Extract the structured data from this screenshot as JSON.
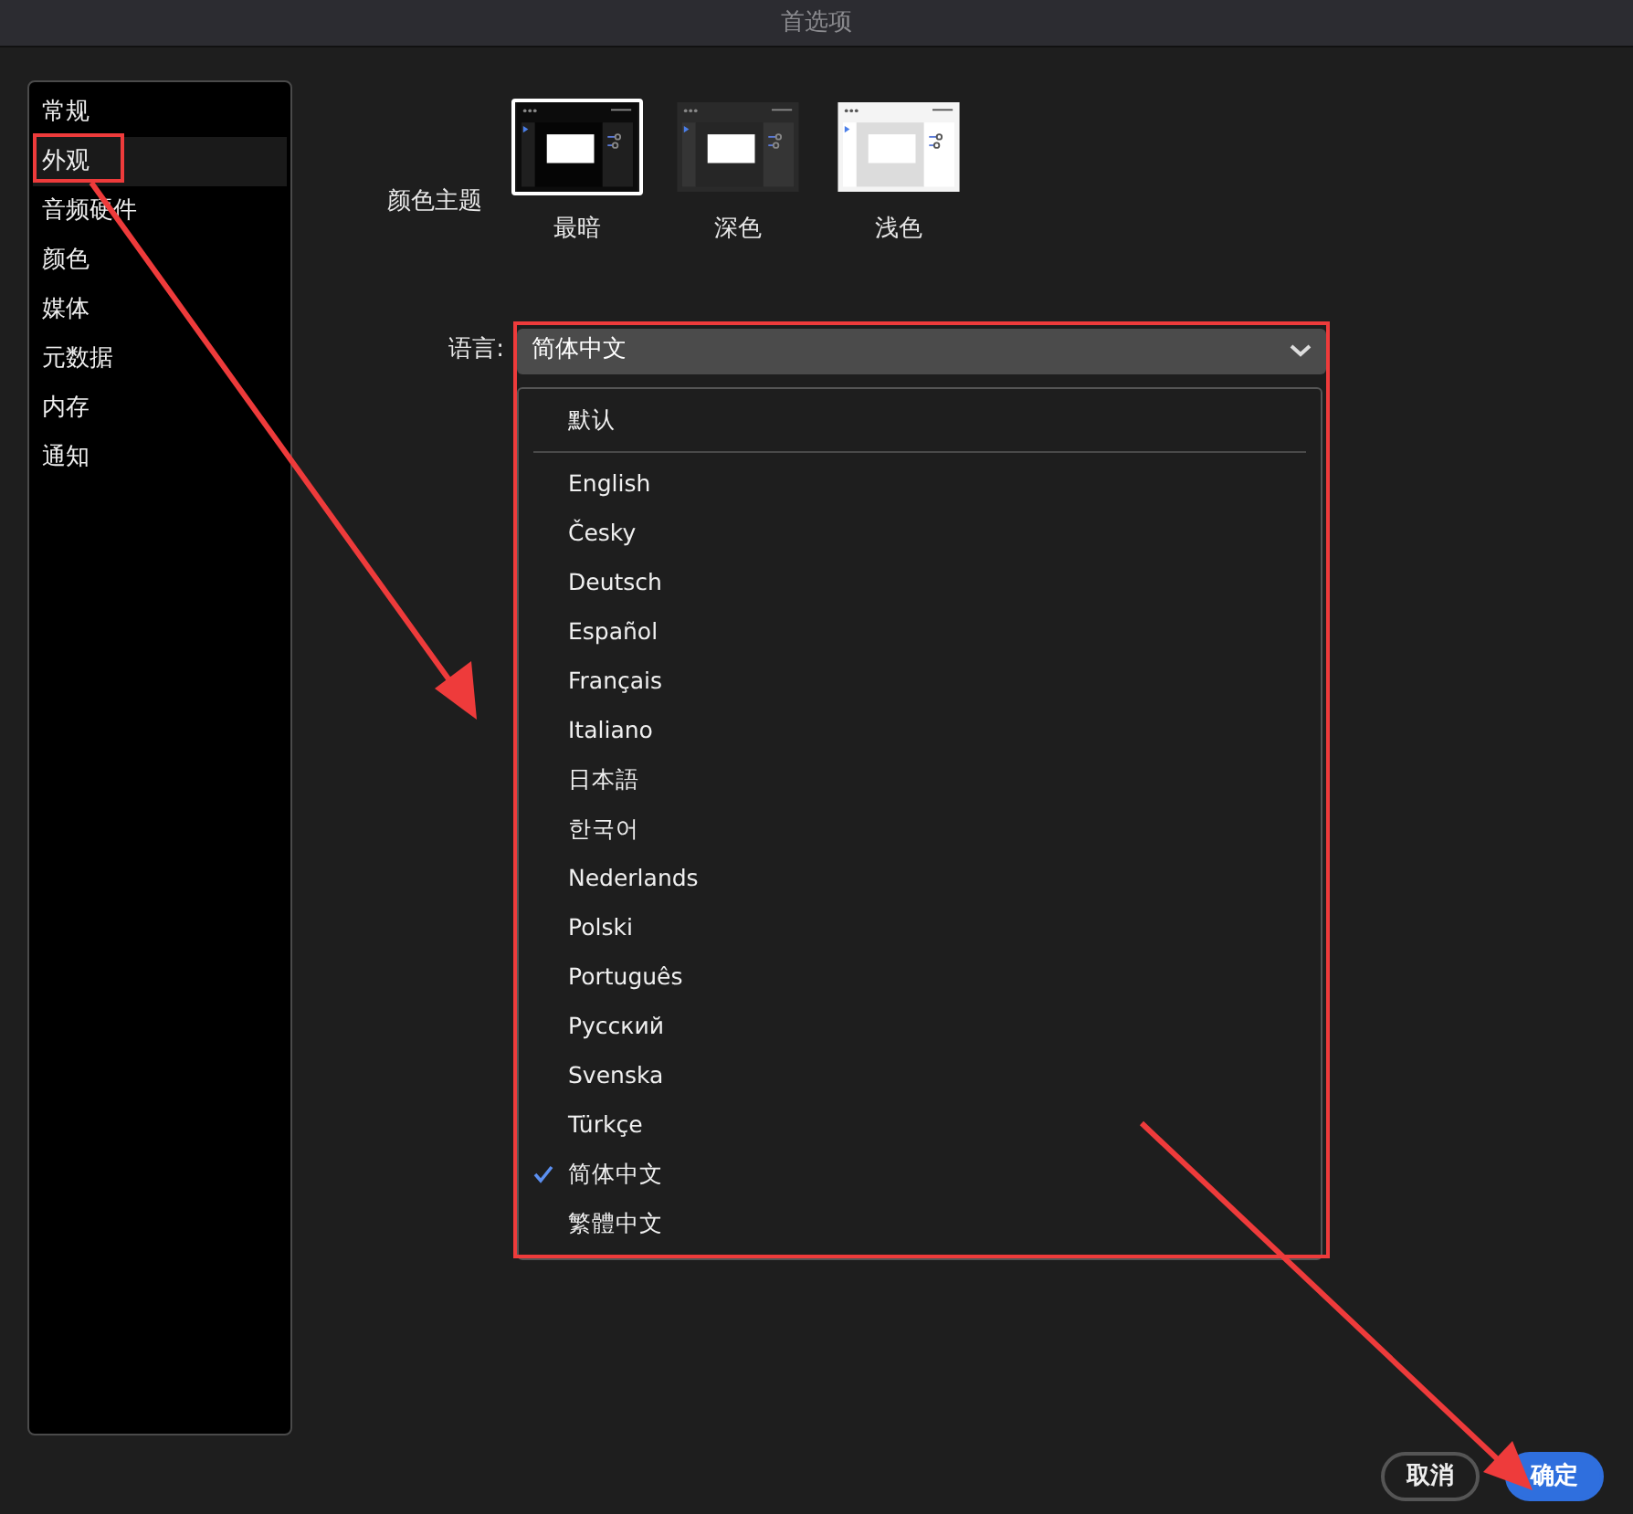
{
  "window": {
    "title": "首选项"
  },
  "sidebar": {
    "items": [
      {
        "label": "常规",
        "selected": false
      },
      {
        "label": "外观",
        "selected": true
      },
      {
        "label": "音频硬件",
        "selected": false
      },
      {
        "label": "颜色",
        "selected": false
      },
      {
        "label": "媒体",
        "selected": false
      },
      {
        "label": "元数据",
        "selected": false
      },
      {
        "label": "内存",
        "selected": false
      },
      {
        "label": "通知",
        "selected": false
      }
    ]
  },
  "color_theme": {
    "label": "颜色主题",
    "options": [
      {
        "label": "最暗",
        "kind": "darkest",
        "selected": true
      },
      {
        "label": "深色",
        "kind": "dark",
        "selected": false
      },
      {
        "label": "浅色",
        "kind": "light",
        "selected": false
      }
    ]
  },
  "language": {
    "label": "语言:",
    "value": "简体中文",
    "default_option": {
      "label": "默认"
    },
    "options": [
      {
        "label": "English",
        "checked": false
      },
      {
        "label": "Česky",
        "checked": false
      },
      {
        "label": "Deutsch",
        "checked": false
      },
      {
        "label": "Español",
        "checked": false
      },
      {
        "label": "Français",
        "checked": false
      },
      {
        "label": "Italiano",
        "checked": false
      },
      {
        "label": "日本語",
        "checked": false
      },
      {
        "label": "한국어",
        "checked": false
      },
      {
        "label": "Nederlands",
        "checked": false
      },
      {
        "label": "Polski",
        "checked": false
      },
      {
        "label": "Português",
        "checked": false
      },
      {
        "label": "Русский",
        "checked": false
      },
      {
        "label": "Svenska",
        "checked": false
      },
      {
        "label": "Türkçe",
        "checked": false
      },
      {
        "label": "简体中文",
        "checked": true
      },
      {
        "label": "繁體中文",
        "checked": false
      }
    ]
  },
  "buttons": [
    {
      "label": "取消",
      "kind": "secondary"
    },
    {
      "label": "确定",
      "kind": "primary"
    }
  ]
}
